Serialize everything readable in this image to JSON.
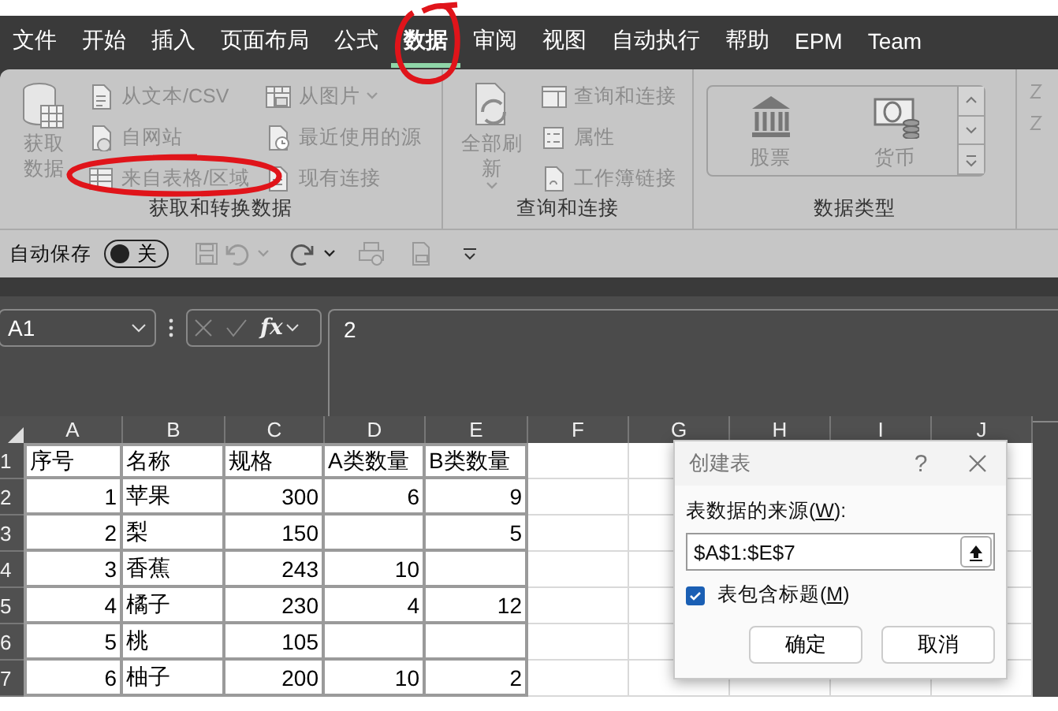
{
  "menu_tabs": [
    {
      "label": "文件",
      "selected": false
    },
    {
      "label": "开始",
      "selected": false
    },
    {
      "label": "插入",
      "selected": false
    },
    {
      "label": "页面布局",
      "selected": false
    },
    {
      "label": "公式",
      "selected": false
    },
    {
      "label": "数据",
      "selected": true
    },
    {
      "label": "审阅",
      "selected": false
    },
    {
      "label": "视图",
      "selected": false
    },
    {
      "label": "自动执行",
      "selected": false
    },
    {
      "label": "帮助",
      "selected": false
    },
    {
      "label": "EPM",
      "selected": false
    },
    {
      "label": "Team",
      "selected": false
    }
  ],
  "ribbon": {
    "disabled": true,
    "groups": [
      {
        "label": "获取和转换数据",
        "big": {
          "label": "获取数据",
          "kind": "database"
        },
        "columns": [
          [
            {
              "label": "从文本/CSV",
              "kind": "text-file"
            },
            {
              "label": "自网站",
              "kind": "web"
            },
            {
              "label": "来自表格/区域",
              "kind": "table"
            }
          ],
          [
            {
              "label": "从图片",
              "kind": "picture",
              "caret": true
            },
            {
              "label": "最近使用的源",
              "kind": "recent"
            },
            {
              "label": "现有连接",
              "kind": "file"
            }
          ]
        ]
      },
      {
        "label": "查询和连接",
        "big": {
          "label": "全部刷新",
          "kind": "refresh",
          "caret": true
        },
        "columns": [
          [
            {
              "label": "查询和连接",
              "kind": "panel"
            },
            {
              "label": "属性",
              "kind": "list"
            },
            {
              "label": "工作簿链接",
              "kind": "link"
            }
          ]
        ]
      },
      {
        "label": "数据类型",
        "gallery": [
          {
            "label": "股票",
            "kind": "bank"
          },
          {
            "label": "货币",
            "kind": "money"
          }
        ]
      }
    ]
  },
  "quick_access": {
    "autosave_label": "自动保存",
    "autosave_state": "关",
    "autosave_on": false
  },
  "formula_bar": {
    "name_box": "A1",
    "function_button": "fx",
    "value": "2"
  },
  "sheet": {
    "columns": [
      "A",
      "B",
      "C",
      "D",
      "E",
      "F",
      "G",
      "H",
      "I",
      "J"
    ],
    "numeric": [
      true,
      false,
      true,
      true,
      true
    ],
    "rows": [
      {
        "number": "1",
        "kind": "header",
        "cells": [
          "序号",
          "名称",
          "规格",
          "A类数量",
          "B类数量"
        ]
      },
      {
        "number": "2",
        "kind": "data",
        "cells": [
          "1",
          "苹果",
          "300",
          "6",
          "9"
        ]
      },
      {
        "number": "3",
        "kind": "data",
        "cells": [
          "2",
          "梨",
          "150",
          null,
          "5"
        ]
      },
      {
        "number": "4",
        "kind": "data",
        "cells": [
          "3",
          "香蕉",
          "243",
          "10",
          null
        ]
      },
      {
        "number": "5",
        "kind": "data",
        "cells": [
          "4",
          "橘子",
          "230",
          "4",
          "12"
        ]
      },
      {
        "number": "6",
        "kind": "data",
        "cells": [
          "5",
          "桃",
          "105",
          null,
          null
        ]
      },
      {
        "number": "7",
        "kind": "data",
        "cells": [
          "6",
          "柚子",
          "200",
          "10",
          "2"
        ]
      }
    ]
  },
  "dialog": {
    "title": "创建表",
    "help": "?",
    "source_label": [
      "表数据的来源(",
      "W",
      "):"
    ],
    "source_value": "$A$1:$E$7",
    "header_checkbox": {
      "label": [
        "表包含标题(",
        "M",
        ")"
      ],
      "checked": true
    },
    "buttons": [
      "确定",
      "取消"
    ]
  }
}
